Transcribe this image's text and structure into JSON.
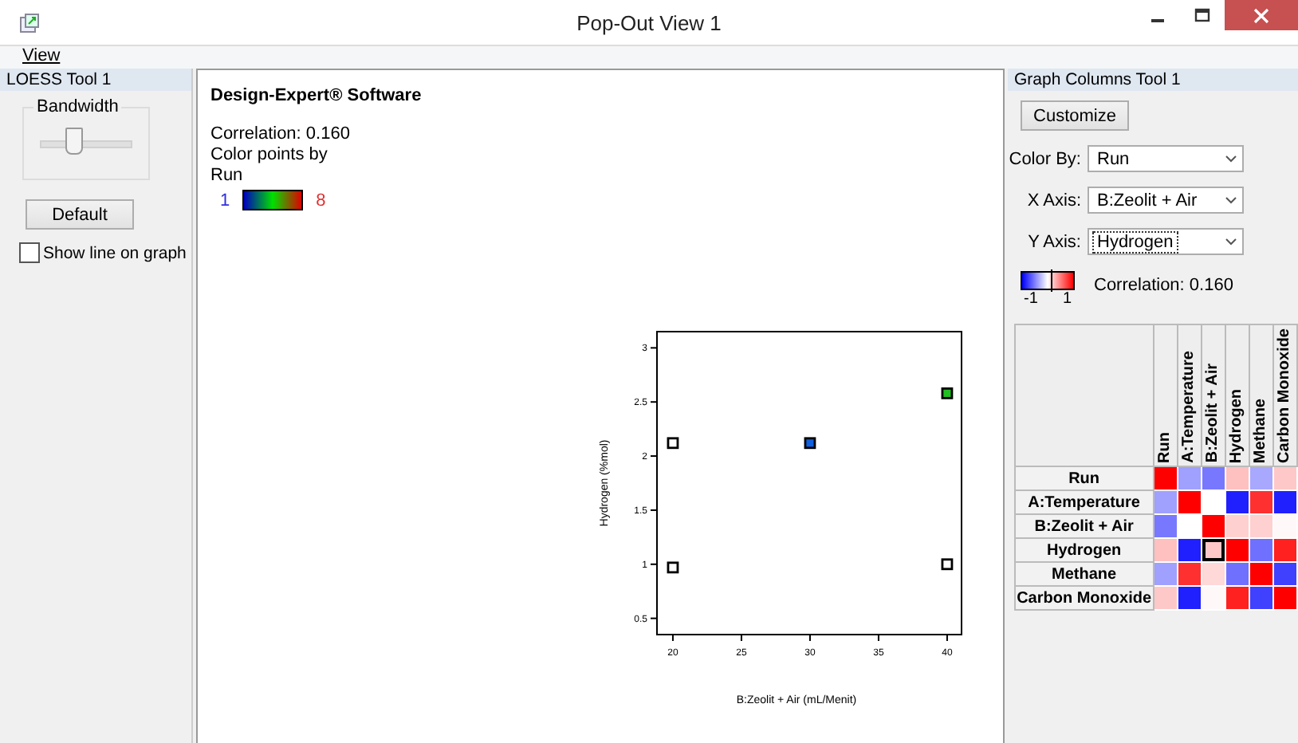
{
  "window": {
    "title": "Pop-Out View 1"
  },
  "menu": [
    {
      "label": "View"
    }
  ],
  "loess": {
    "title": "LOESS Tool 1",
    "group_label": "Bandwidth",
    "bandwidth": {
      "level": 0.35
    },
    "default_button": "Default",
    "show_line": {
      "label": "Show line on graph",
      "checked": false
    }
  },
  "graph": {
    "heading": "Design-Expert® Software",
    "lines": [
      "Correlation: 0.160",
      "Color points by",
      "Run"
    ],
    "legend_min": "1",
    "legend_max": "8",
    "chart_data": {
      "type": "scatter",
      "xlabel": "B:Zeolit + Air (mL/Menit)",
      "ylabel": "Hydrogen (%mol)",
      "x": [
        20,
        20,
        30,
        40,
        40
      ],
      "xlim": [
        18.84,
        41.05
      ],
      "ylim": [
        0.35,
        3.15
      ],
      "xticks": [
        20,
        25,
        30,
        35,
        40
      ],
      "yticks": [
        0.5,
        1,
        1.5,
        2,
        2.5,
        3
      ],
      "series": [
        {
          "color": "#ffffff",
          "values": [
            2.12,
            0.97,
            null,
            null,
            1.0
          ]
        },
        {
          "color": "#1060e0",
          "values": [
            null,
            null,
            2.12,
            null,
            null
          ]
        },
        {
          "color": "#20c020",
          "values": [
            null,
            null,
            null,
            2.58,
            null
          ]
        }
      ]
    }
  },
  "columns_tool": {
    "title": "Graph Columns Tool 1",
    "customize_button": "Customize",
    "fields": [
      {
        "label": "Color By:",
        "value": "Run",
        "focused": false
      },
      {
        "label": "X Axis:",
        "value": "B:Zeolit + Air",
        "focused": false
      },
      {
        "label": "Y Axis:",
        "value": "Hydrogen",
        "focused": true
      }
    ],
    "scale_min": "-1",
    "scale_max": "1",
    "correlation": "Correlation: 0.160",
    "matrix": {
      "columns": [
        "Run",
        "A:Temperature",
        "B:Zeolit + Air",
        "Hydrogen",
        "Methane",
        "Carbon Monoxide"
      ],
      "rows": [
        {
          "label": "Run",
          "cells": [
            {
              "color": "#ff0000",
              "selected": false
            },
            {
              "color": "#a0a0ff",
              "selected": false
            },
            {
              "color": "#7878ff",
              "selected": false
            },
            {
              "color": "#ffc0c0",
              "selected": false
            },
            {
              "color": "#a8a8ff",
              "selected": false
            },
            {
              "color": "#ffc8c8",
              "selected": false
            }
          ]
        },
        {
          "label": "A:Temperature",
          "cells": [
            {
              "color": "#a0a0ff",
              "selected": false
            },
            {
              "color": "#ff0000",
              "selected": false
            },
            {
              "color": "#ffffff",
              "selected": false
            },
            {
              "color": "#2020ff",
              "selected": false
            },
            {
              "color": "#ff3030",
              "selected": false
            },
            {
              "color": "#2020ff",
              "selected": false
            }
          ]
        },
        {
          "label": "B:Zeolit + Air",
          "cells": [
            {
              "color": "#7878ff",
              "selected": false
            },
            {
              "color": "#ffffff",
              "selected": false
            },
            {
              "color": "#ff0000",
              "selected": false
            },
            {
              "color": "#ffd0d0",
              "selected": false
            },
            {
              "color": "#ffd0d0",
              "selected": false
            },
            {
              "color": "#fff8f8",
              "selected": false
            }
          ]
        },
        {
          "label": "Hydrogen",
          "cells": [
            {
              "color": "#ffc0c0",
              "selected": false
            },
            {
              "color": "#2020ff",
              "selected": false
            },
            {
              "color": "#ffc8c8",
              "selected": true
            },
            {
              "color": "#ff0000",
              "selected": false
            },
            {
              "color": "#7070ff",
              "selected": false
            },
            {
              "color": "#ff2020",
              "selected": false
            }
          ]
        },
        {
          "label": "Methane",
          "cells": [
            {
              "color": "#a0a0ff",
              "selected": false
            },
            {
              "color": "#ff3030",
              "selected": false
            },
            {
              "color": "#ffd8d8",
              "selected": false
            },
            {
              "color": "#7070ff",
              "selected": false
            },
            {
              "color": "#ff0000",
              "selected": false
            },
            {
              "color": "#4040ff",
              "selected": false
            }
          ]
        },
        {
          "label": "Carbon Monoxide",
          "cells": [
            {
              "color": "#ffc8c8",
              "selected": false
            },
            {
              "color": "#2020ff",
              "selected": false
            },
            {
              "color": "#fff8f8",
              "selected": false
            },
            {
              "color": "#ff2020",
              "selected": false
            },
            {
              "color": "#4040ff",
              "selected": false
            },
            {
              "color": "#ff0000",
              "selected": false
            }
          ]
        }
      ]
    }
  }
}
